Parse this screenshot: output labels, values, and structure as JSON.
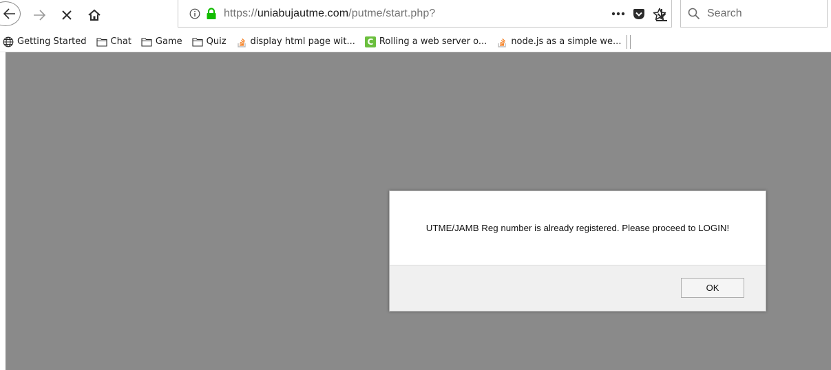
{
  "toolbar": {
    "url_prefix": "https://",
    "url_host": "uniabujautme.com",
    "url_path": "/putme/start.php?",
    "search_placeholder": "Search"
  },
  "bookmarks": [
    {
      "label": "Getting Started",
      "icon": "globe-icon"
    },
    {
      "label": "Chat",
      "icon": "folder-icon"
    },
    {
      "label": "Game",
      "icon": "folder-icon"
    },
    {
      "label": "Quiz",
      "icon": "folder-icon"
    },
    {
      "label": "display html page wit...",
      "icon": "stackoverflow-icon"
    },
    {
      "label": "Rolling a web server o...",
      "icon": "c-site-icon"
    },
    {
      "label": "node.js as a simple we...",
      "icon": "stackoverflow-icon"
    }
  ],
  "dialog": {
    "message": "UTME/JAMB Reg number is already registered. Please proceed to LOGIN!",
    "ok_label": "OK"
  },
  "colors": {
    "overlay": "#8a8a8a",
    "lock_green": "#12bc00",
    "c_icon_green": "#6bbf3e",
    "stackoverflow_orange": "#f48024"
  }
}
